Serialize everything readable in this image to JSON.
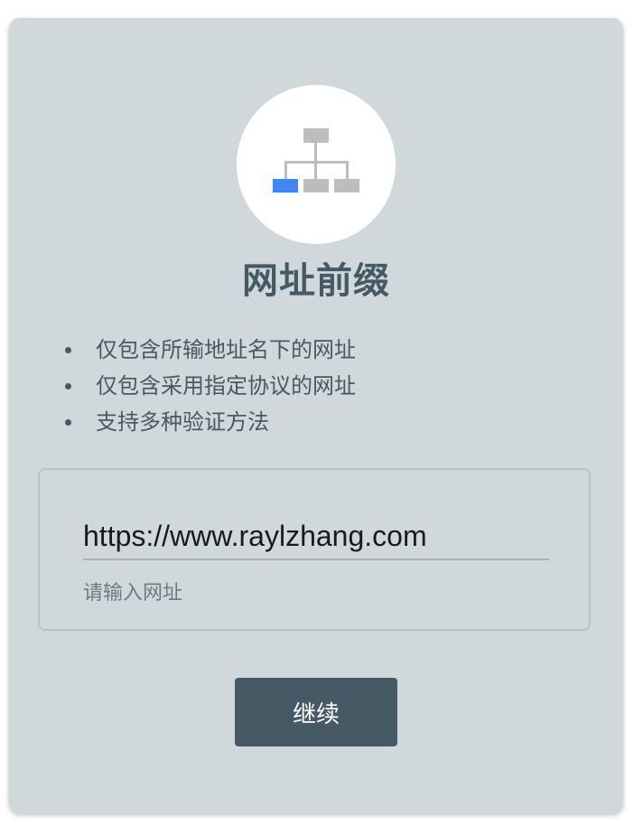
{
  "dialog": {
    "icon": "sitemap-icon",
    "title": "网址前缀",
    "features": [
      "仅包含所输地址名下的网址",
      "仅包含采用指定协议的网址",
      "支持多种验证方法"
    ],
    "url_input": {
      "value": "https://www.raylzhang.com",
      "helper_text": "请输入网址"
    },
    "continue_label": "继续"
  },
  "colors": {
    "card_background": "#d1d8dc",
    "primary": "#455a64",
    "highlight_node": "#4285f4",
    "node_gray": "#bdbdbd"
  }
}
